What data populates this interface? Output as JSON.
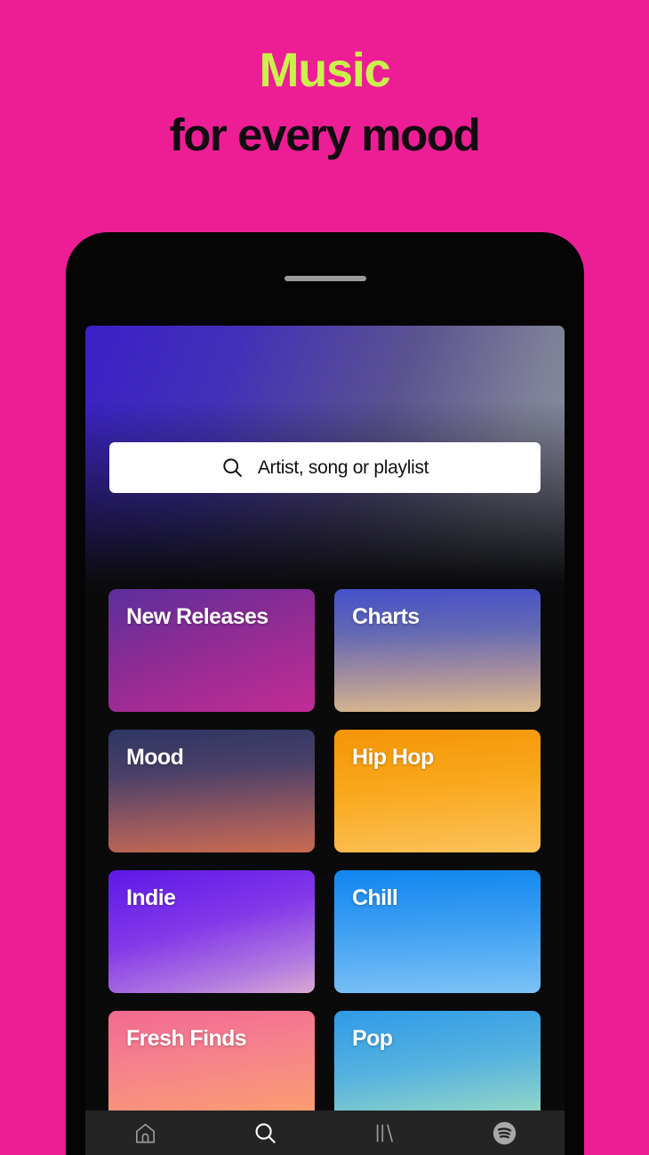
{
  "poster": {
    "background_color": "#ED1E95",
    "headline": {
      "line1": "Music",
      "line1_color": "#CBF24C",
      "line2": "for every mood",
      "line2_color": "#120C10"
    }
  },
  "phone": {
    "body_color": "#050505",
    "speaker_label": "earpiece-speaker"
  },
  "app": {
    "screen_background": "#0A0A0A",
    "search": {
      "placeholder": "Artist, song or playlist",
      "icon": "search-icon",
      "background_color": "#FFFFFF",
      "text_color": "#111111"
    },
    "tiles": [
      {
        "label": "New Releases",
        "key": "new-releases",
        "from": "#5B2E9E",
        "to": "#C22C95"
      },
      {
        "label": "Charts",
        "key": "charts",
        "from": "#4550C9",
        "to": "#DCBB8C"
      },
      {
        "label": "Mood",
        "key": "mood",
        "from": "#2F3663",
        "to": "#C96B50"
      },
      {
        "label": "Hip Hop",
        "key": "hip-hop",
        "from": "#F59406",
        "to": "#FCC25A"
      },
      {
        "label": "Indie",
        "key": "indie",
        "from": "#5C18E8",
        "to": "#D9A9D2"
      },
      {
        "label": "Chill",
        "key": "chill",
        "from": "#1186F0",
        "to": "#7CC2F7"
      },
      {
        "label": "Fresh Finds",
        "key": "fresh-finds",
        "from": "#F36A92",
        "to": "#FDB064"
      },
      {
        "label": "Pop",
        "key": "pop",
        "from": "#2F9BE8",
        "to": "#A7E2BF"
      }
    ],
    "bottom_nav": {
      "background_color": "#242424",
      "active_color": "#FFFFFF",
      "inactive_color": "#9A9A9A",
      "items": [
        {
          "name": "home",
          "icon": "home-icon",
          "active": false
        },
        {
          "name": "search",
          "icon": "search-icon",
          "active": true
        },
        {
          "name": "library",
          "icon": "library-icon",
          "active": false
        },
        {
          "name": "spotify",
          "icon": "spotify-icon",
          "active": false
        }
      ]
    }
  }
}
